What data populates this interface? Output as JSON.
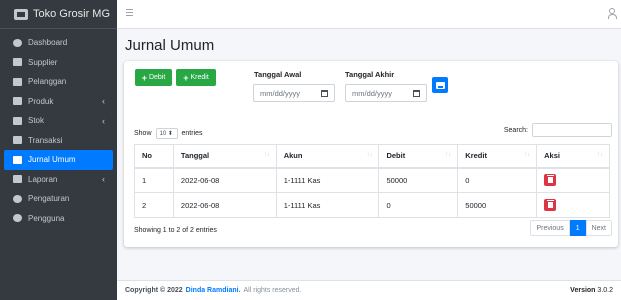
{
  "brand": {
    "name": "Toko Grosir MG"
  },
  "sidebar": {
    "items": [
      {
        "label": "Dashboard"
      },
      {
        "label": "Supplier"
      },
      {
        "label": "Pelanggan"
      },
      {
        "label": "Produk"
      },
      {
        "label": "Stok"
      },
      {
        "label": "Transaksi"
      },
      {
        "label": "Jurnal Umum"
      },
      {
        "label": "Laporan"
      },
      {
        "label": "Pengaturan"
      },
      {
        "label": "Pengguna"
      }
    ]
  },
  "page": {
    "title": "Jurnal Umum"
  },
  "toolbar": {
    "debit_label": "Debit",
    "kredit_label": "Kredit",
    "start_label": "Tanggal Awal",
    "end_label": "Tanggal Akhir",
    "date_placeholder": "mm/dd/yyyy"
  },
  "table_controls": {
    "show": "Show",
    "entries_value": "10",
    "entries": "entries",
    "search": "Search:"
  },
  "table": {
    "headers": [
      "No",
      "Tanggal",
      "Akun",
      "Debit",
      "Kredit",
      "Aksi"
    ],
    "rows": [
      [
        "1",
        "2022-06-08",
        "1-1111 Kas",
        "50000",
        "0"
      ],
      [
        "2",
        "2022-06-08",
        "1-1111 Kas",
        "0",
        "50000"
      ]
    ]
  },
  "pagination": {
    "info": "Showing 1 to 2 of 2 entries",
    "previous": "Previous",
    "current": "1",
    "next": "Next"
  },
  "footer": {
    "copyright": "Copyright © 2022",
    "author": "Dinda Ramdiani.",
    "rights": "All rights reserved.",
    "version_label": "Version",
    "version": "3.0.2"
  },
  "colors": {
    "sidebar": "#343a40",
    "primary": "#007bff",
    "success": "#28a745",
    "danger": "#dc3545"
  },
  "icons": [
    "bars-icon",
    "user-icon",
    "tachometer-icon",
    "truck-icon",
    "address-card-icon",
    "box-icon",
    "warehouse-icon",
    "money-icon",
    "book-icon",
    "file-icon",
    "cog-icon",
    "users-icon",
    "calendar-icon",
    "print-icon",
    "trash-icon"
  ]
}
